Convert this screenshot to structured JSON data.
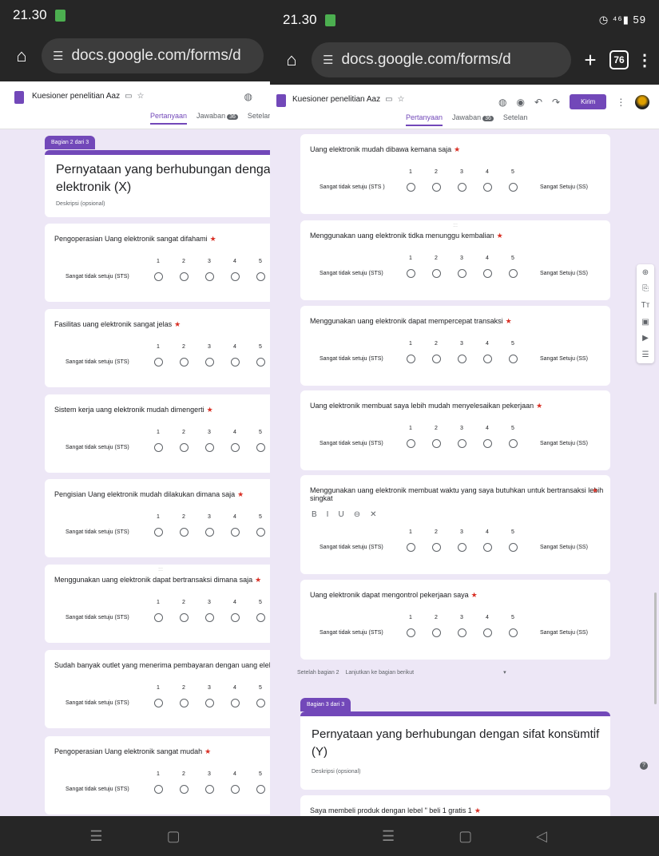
{
  "left": {
    "status": {
      "time": "21.30"
    },
    "url": "docs.google.com/forms/d",
    "form_title": "Kuesioner penelitian Aaz",
    "tabs": {
      "questions": "Pertanyaan",
      "responses": "Jawaban",
      "responses_count": "36",
      "settings": "Setelan"
    },
    "section": {
      "tag": "Bagian 2 dari 3",
      "title_line1": "Pernyataan yang berhubungan dengan uang",
      "title_line2": "elektronik (X)",
      "description_placeholder": "Deskripsi (opsional)"
    },
    "scale_numbers": [
      "1",
      "2",
      "3",
      "4",
      "5"
    ],
    "low_label": "Sangat tidak setuju (STS)",
    "questions": [
      "Pengoperasian Uang elektronik sangat difahami",
      "Fasilitas uang elektronik sangat jelas",
      "Sistem kerja uang elektronik mudah dimengerti",
      "Pengisian Uang elektronik mudah dilakukan dimana saja",
      "Menggunakan uang elektronik dapat bertransaksi dimana saja",
      "Sudah banyak outlet yang menerima pembayaran dengan uang elektronik",
      "Pengoperasian Uang elektronik sangat mudah"
    ]
  },
  "right": {
    "status": {
      "time": "21.30",
      "icons": "◷ ⁴⁶▮ 59"
    },
    "url": "docs.google.com/forms/d",
    "tab_count": "76",
    "form_title": "Kuesioner penelitian Aaz",
    "send_button": "Kirim",
    "tabs": {
      "questions": "Pertanyaan",
      "responses": "Jawaban",
      "responses_count": "36",
      "settings": "Setelan"
    },
    "scale_numbers": [
      "1",
      "2",
      "3",
      "4",
      "5"
    ],
    "low_label_first": "Sangat tidak setuju (STS )",
    "low_label": "Sangat tidak setuju (STS)",
    "high_label": "Sangat Setuju (SS)",
    "questions": [
      "Uang elektronik mudah dibawa kemana saja",
      "Menggunakan uang elektronik tidka menunggu kembalian",
      "Menggunakan uang elektronik dapat mempercepat transaksi",
      "Uang elektronik membuat saya lebih mudah menyelesaikan pekerjaan",
      "Menggunakan uang elektronik membuat waktu yang saya butuhkan untuk bertransaksi lebih",
      "Uang elektronik dapat mengontrol pekerjaan saya"
    ],
    "question5_line2": "singkat",
    "format_tools": [
      "B",
      "I",
      "U",
      "⊖",
      "✕"
    ],
    "after_section": {
      "label": "Setelah bagian 2",
      "value": "Lanjutkan ke bagian berikut"
    },
    "section3": {
      "tag": "Bagian 3 dari 3",
      "title_line1": "Pernyataan yang berhubungan dengan sifat konsumtif",
      "title_line2": "(Y)",
      "description_placeholder": "Deskripsi (opsional)"
    },
    "last_question": "Saya membeli produk dengan lebel \" beli 1 gratis 1"
  }
}
